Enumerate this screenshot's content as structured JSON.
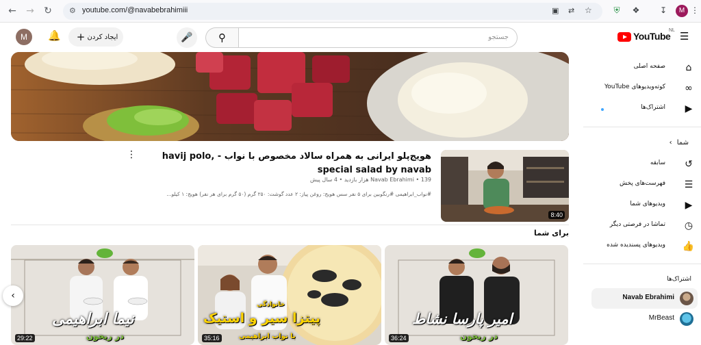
{
  "browser": {
    "url": "youtube.com/@navabebrahimiii",
    "profile_initial": "M"
  },
  "header": {
    "search_placeholder": "جستجو",
    "create_label": "ایجاد کردن",
    "logo_text": "YouTube",
    "country_code": "NL",
    "avatar_initial": "M"
  },
  "sidebar": {
    "main_items": [
      {
        "label": "صفحه اصلی",
        "icon": "home-icon"
      },
      {
        "label": "کوته‌ویدیوهای YouTube",
        "icon": "shorts-icon"
      },
      {
        "label": "اشتراک‌ها",
        "icon": "subscriptions-icon"
      }
    ],
    "you_heading": "شما",
    "you_items": [
      {
        "label": "سابقه",
        "icon": "history-icon"
      },
      {
        "label": "فهرست‌های پخش",
        "icon": "playlists-icon"
      },
      {
        "label": "ویدیوهای شما",
        "icon": "your-videos-icon"
      },
      {
        "label": "تماشا در فرصتی دیگر",
        "icon": "watch-later-icon"
      },
      {
        "label": "ویدیوهای پسندیده شده",
        "icon": "liked-videos-icon"
      }
    ],
    "subscriptions_heading": "اشتراک‌ها",
    "subscriptions": [
      {
        "name": "Navab Ebrahimi"
      },
      {
        "name": "MrBeast"
      }
    ]
  },
  "featured": {
    "title": "هویج‌پلو ایرانی به همراه سالاد مخصوص با نواب - havij polo, special salad by navab",
    "meta": "Navab Ebrahimi • 139 هزار بازدید • 4 سال پیش",
    "description": "#نواب_ابراهیمی #رنگوبین برای ۵ نفر سس هویج: روغن پیاز: ۲ عدد گوشت: ۲۵۰ گرم (۵۰ گرم برای هر نفر) هویج: ۱ کیلو...",
    "duration": "8:40"
  },
  "section": {
    "for_you": "برای شما"
  },
  "cards": [
    {
      "name_text": "امیر پارسا نشاط",
      "sub_text": "در ریحون",
      "duration": "36:24"
    },
    {
      "name_text": "پیتزا سیر و استیک",
      "sub_text": "با نواب ابراهیمی",
      "badge": "خانوادگی",
      "duration": "35:16"
    },
    {
      "name_text": "نیما ابراهیمی",
      "sub_text": "در ریحون",
      "duration": "29:22"
    }
  ],
  "colors": {
    "accent_red": "#ff0000",
    "link_blue": "#3ea6ff",
    "card_green": "#7bbf3a",
    "card_yellow": "#ffd400"
  }
}
